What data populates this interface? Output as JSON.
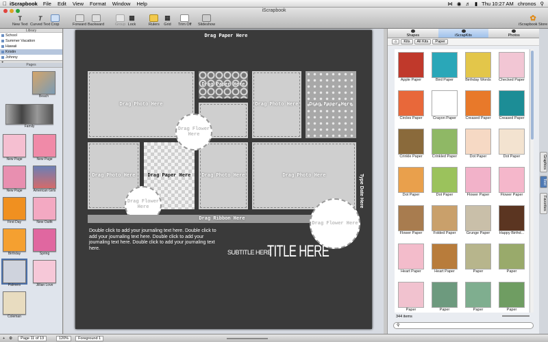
{
  "menubar": {
    "app_name": "iScrapbook",
    "items": [
      "File",
      "Edit",
      "View",
      "Format",
      "Window",
      "Help"
    ],
    "clock": "Thu 10:27 AM",
    "user": "chronos"
  },
  "window": {
    "title": "iScrapbook"
  },
  "toolbar": {
    "new_text": "New Text",
    "curved_text": "Curved Text",
    "crop": "Crop",
    "forward": "Forward",
    "backward": "Backward",
    "group": "Group",
    "lock": "Lock",
    "rulers": "Rulers",
    "grid": "Grid",
    "trim_off": "Trim Off",
    "slideshow": "Slideshow",
    "store": "iScrapbook Store"
  },
  "library": {
    "header": "Library",
    "items": [
      "School",
      "Summer Vacation",
      "Hawaii",
      "Kristin",
      "Johnny"
    ],
    "selected": "Kristin"
  },
  "pages": {
    "header": "Pages",
    "items": [
      "Beach",
      "Family",
      "New Page",
      "New Page",
      "New Page",
      "American Girls",
      "First Day",
      "New Outfit",
      "Birthday",
      "Spring",
      "Palmers",
      "Jillian Love",
      "Coleman"
    ]
  },
  "canvas": {
    "drag_paper_top": "Drag Paper Here",
    "drag_photo": "Drag Photo Here",
    "drag_paper": "Drag Paper Here",
    "drag_flower": "Drag Flower Here",
    "drag_ribbon": "Drag Ribbon Here",
    "journal_text": "Double click to add your journaling text here. Double click to add your journaling text here. Double click to add your journaling text here. Double click to add your journaling text here.",
    "subtitle": "SUBTITLE HERE",
    "title": "TITLE HERE",
    "date_text": "Type Date Here",
    "zoom": "120%",
    "layer": "Foreground 1"
  },
  "status": {
    "page_of": "Page 11 of 13"
  },
  "kit_panel": {
    "tabs": [
      "Shapes",
      "iScrapKits",
      "Photos"
    ],
    "active_tab": "iScrapKits",
    "crumbs": [
      "Kits",
      "All Kits",
      "Paper"
    ],
    "items": [
      {
        "name": "Apple Paper",
        "color": "#c0392b"
      },
      {
        "name": "Bird Paper",
        "color": "#2aa7b8"
      },
      {
        "name": "Birthday Words",
        "color": "#e3c64a"
      },
      {
        "name": "Checked Paper",
        "color": "#f2c6d4"
      },
      {
        "name": "Circles Paper",
        "color": "#e8683a"
      },
      {
        "name": "Crayon Paper",
        "color": "#ffffff"
      },
      {
        "name": "Creased Paper",
        "color": "#e8792a"
      },
      {
        "name": "Creased Paper",
        "color": "#1c8d96"
      },
      {
        "name": "Crinkle Paper",
        "color": "#8a6a3b"
      },
      {
        "name": "Crinkled Paper",
        "color": "#8fb865"
      },
      {
        "name": "Dot Paper",
        "color": "#f6d9c4"
      },
      {
        "name": "Dot Paper",
        "color": "#f3e3d0"
      },
      {
        "name": "Dot Paper",
        "color": "#e9a04c"
      },
      {
        "name": "Dot Paper",
        "color": "#9bc25c"
      },
      {
        "name": "Flower Paper",
        "color": "#f2b2c9"
      },
      {
        "name": "Flower Paper",
        "color": "#f5b7cb"
      },
      {
        "name": "Flower Paper",
        "color": "#a87c4f"
      },
      {
        "name": "Folded Paper",
        "color": "#c9a06b"
      },
      {
        "name": "Grunge Paper",
        "color": "#c9bfa9"
      },
      {
        "name": "Happy Birthd...",
        "color": "#5b3521"
      },
      {
        "name": "Heart Paper",
        "color": "#f3bccb"
      },
      {
        "name": "Heart Paper",
        "color": "#b87c3b"
      },
      {
        "name": "Paper",
        "color": "#b7b58c"
      },
      {
        "name": "Paper",
        "color": "#99aa6b"
      },
      {
        "name": "Paper",
        "color": "#f1c2cf"
      },
      {
        "name": "Paper",
        "color": "#6d9a7e"
      },
      {
        "name": "Paper",
        "color": "#7fae8f"
      },
      {
        "name": "Paper",
        "color": "#6f9d62"
      }
    ],
    "count": "344 items",
    "search_placeholder": ""
  },
  "side_tabs": [
    "Graphics",
    "Text",
    "Favorites"
  ]
}
